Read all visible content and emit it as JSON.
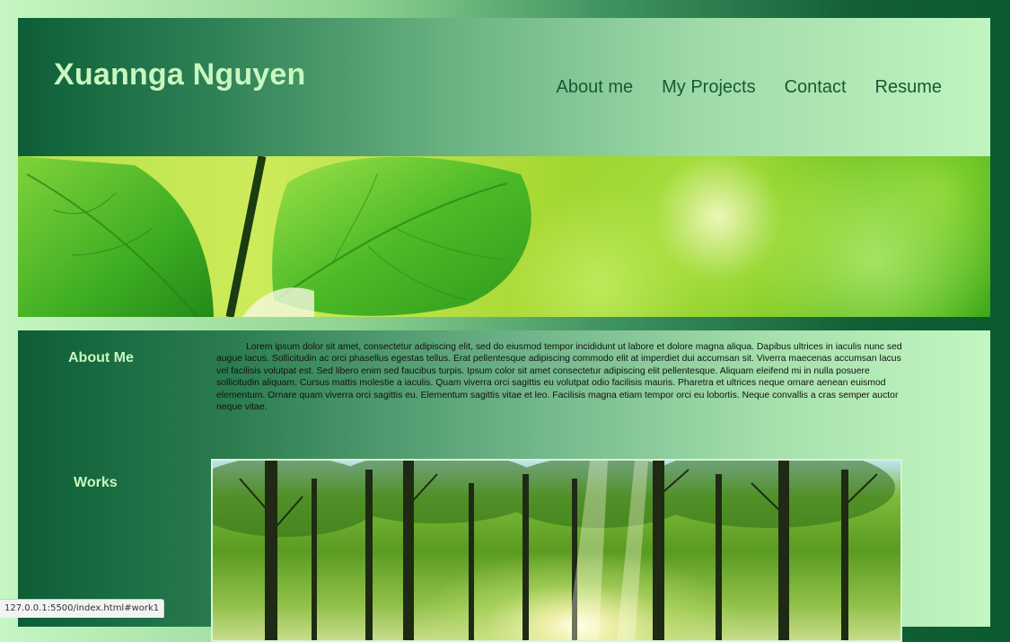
{
  "header": {
    "title": "Xuannga Nguyen",
    "nav": [
      "About me",
      "My Projects",
      "Contact",
      "Resume"
    ]
  },
  "banner": {
    "image": "green leaves macro photo"
  },
  "about": {
    "heading": "About Me",
    "body": "Lorem ipsum dolor sit amet, consectetur adipiscing elit, sed do eiusmod tempor incididunt ut labore et dolore magna aliqua. Dapibus ultrices in iaculis nunc sed augue lacus. Sollicitudin ac orci phasellus egestas tellus. Erat pellentesque adipiscing commodo elit at imperdiet dui accumsan sit. Viverra maecenas accumsan lacus vel facilisis volutpat est. Sed libero enim sed faucibus turpis. Ipsum color sit amet consectetur adipiscing elit pellentesque. Aliquam eleifend mi in nulla posuere sollicitudin aliquam. Cursus mattis molestie a iaculis. Quam viverra orci sagittis eu volutpat odio facilisis mauris. Pharetra et ultrices neque ornare aenean euismod elementum. Ornare quam viverra orci sagittis eu. Elementum sagittis vitae et leo. Facilisis magna etiam tempor orci eu lobortis. Neque convallis a cras semper auctor neque vitae."
  },
  "works": {
    "heading": "Works",
    "image": "sunlit forest photo"
  },
  "status_bar": {
    "url": "127.0.0.1:5500/index.html#work1"
  },
  "colors": {
    "title": "#c8f7c0",
    "nav": "#155a32",
    "dark_green": "#0d5e37",
    "light_green": "#c2f6c2"
  }
}
